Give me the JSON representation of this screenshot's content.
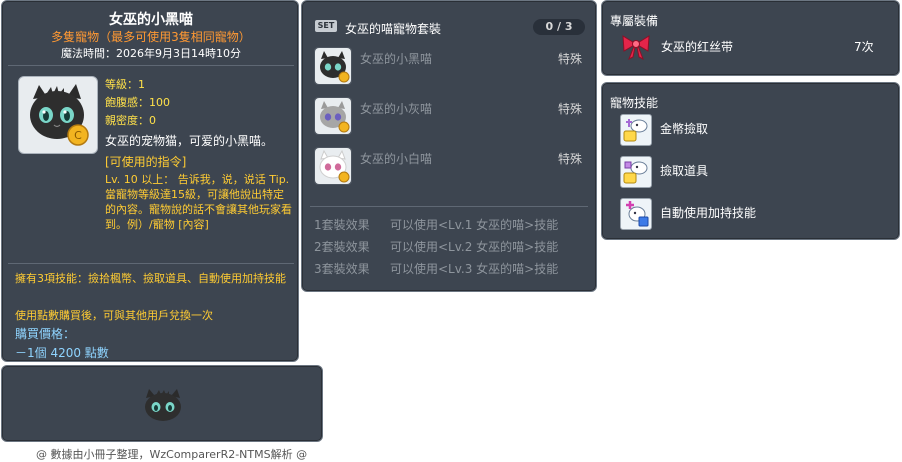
{
  "item_id": "05000636",
  "tooltip": {
    "title": "女巫的小黑喵",
    "subtitle": "多隻寵物（最多可使用3隻相同寵物）",
    "expire": "魔法時間：2026年9月3日14時10分",
    "stats": {
      "level": "等級：1",
      "fullness": "飽腹感：100",
      "closeness": "親密度：0"
    },
    "description": "女巫的宠物猫，可爱的小黑喵。",
    "commands_heading": "[可使用的指令]",
    "commands_text": "Lv. 10 以上： 告诉我，说，说话 Tip. 當寵物等級達15級，可讓他說出特定的內容。寵物說的話不會讓其他玩家看到。例）/寵物 [內容]",
    "skills_line": "擁有3項技能：撿拾楓幣、撿取道具、自動使用加持技能",
    "trade_line": "使用點數購買後，可與其他用戶兌換一次",
    "price_heading": "購買價格：",
    "price_value": "－1個 4200 點數"
  },
  "footer": "@ 數據由小冊子整理，WzComparerR2-NTMS解析 @",
  "set": {
    "badge": "SET",
    "title": "女巫的喵寵物套裝",
    "count": "0 / 3",
    "members": [
      {
        "name": "女巫的小黑喵",
        "type": "特殊",
        "icon": "black-cat-icon"
      },
      {
        "name": "女巫的小灰喵",
        "type": "特殊",
        "icon": "gray-cat-icon"
      },
      {
        "name": "女巫的小白喵",
        "type": "特殊",
        "icon": "white-cat-icon"
      }
    ],
    "effects": [
      {
        "label": "1套裝效果",
        "text": "可以使用<Lv.1 女巫的喵>技能"
      },
      {
        "label": "2套裝效果",
        "text": "可以使用<Lv.2 女巫的喵>技能"
      },
      {
        "label": "3套裝效果",
        "text": "可以使用<Lv.3 女巫的喵>技能"
      }
    ]
  },
  "exclusive": {
    "heading": "專屬裝備",
    "item_name": "女巫的红丝带",
    "item_count": "7次",
    "icon": "red-ribbon-icon"
  },
  "pet_skills": {
    "heading": "寵物技能",
    "items": [
      {
        "name": "金幣撿取",
        "icon": "meso-pickup-icon"
      },
      {
        "name": "撿取道具",
        "icon": "item-pickup-icon"
      },
      {
        "name": "自動使用加持技能",
        "icon": "auto-buff-icon"
      }
    ]
  },
  "colors": {
    "panel_bg": "#3d4550",
    "subtitle_orange": "#ff9933",
    "stat_yellow": "#ffe14a",
    "price_blue": "#8fd4ff"
  }
}
